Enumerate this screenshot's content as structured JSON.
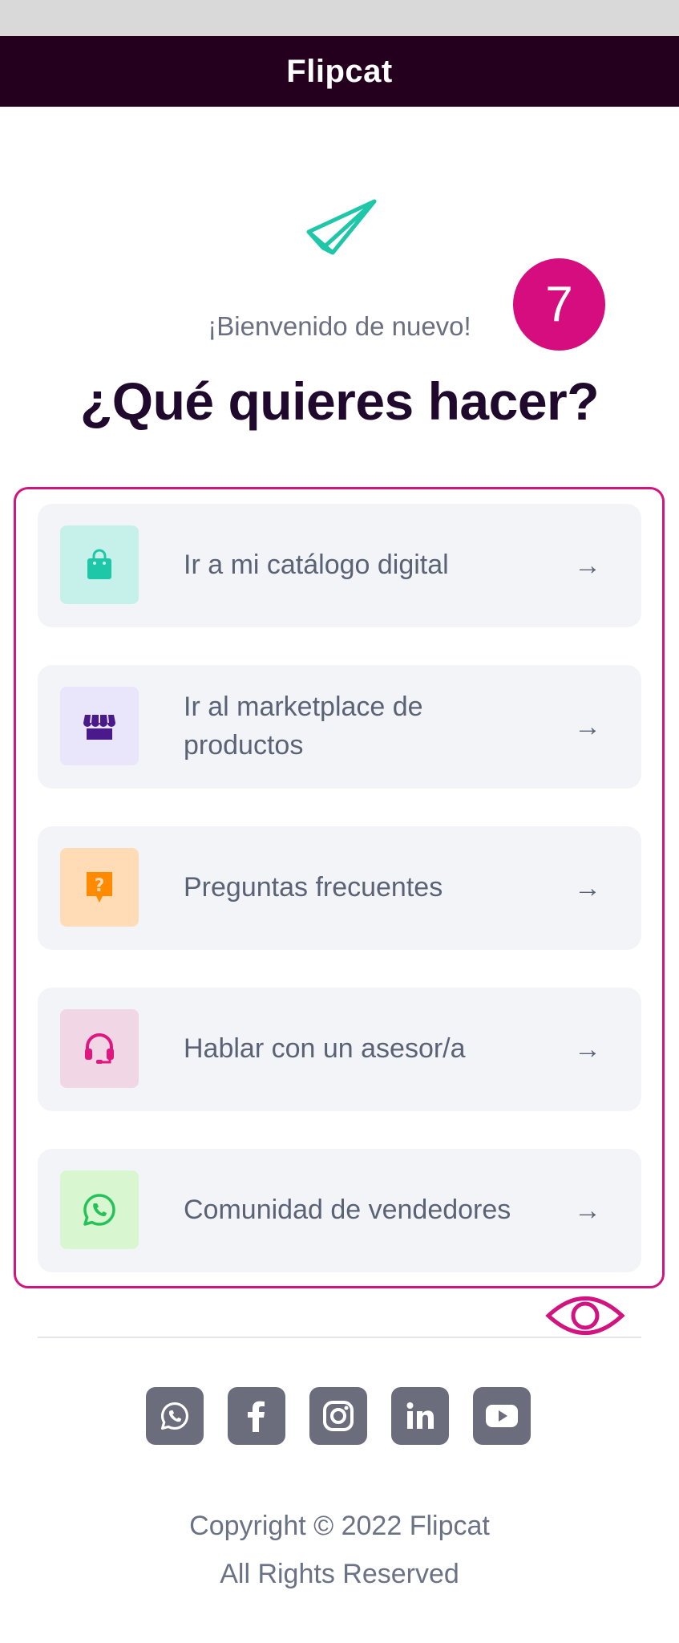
{
  "header": {
    "title": "Flipcat"
  },
  "logo": {
    "icon": "paper-plane-icon",
    "color": "#1ec7a8"
  },
  "welcome_text": "¡Bienvenido de nuevo!",
  "question": "¿Qué quieres hacer?",
  "step_badge": {
    "number": "7",
    "color": "#d60d7e"
  },
  "options": [
    {
      "label": "Ir a mi catálogo digital",
      "icon": "shopping-bag-icon",
      "icon_bg": "#c5f1ea",
      "icon_color": "#1ec7a8",
      "arrow": "→"
    },
    {
      "label": "Ir al marketplace de productos",
      "icon": "store-icon",
      "icon_bg": "#e9e5fb",
      "icon_color": "#4a1a8c",
      "arrow": "→"
    },
    {
      "label": "Preguntas frecuentes",
      "icon": "question-icon",
      "icon_bg": "#ffdcb5",
      "icon_color": "#ff8a00",
      "arrow": "→"
    },
    {
      "label": "Hablar con un asesor/a",
      "icon": "headset-icon",
      "icon_bg": "#f1d6e6",
      "icon_color": "#e0177f",
      "arrow": "→"
    },
    {
      "label": "Comunidad de vendedores",
      "icon": "whatsapp-icon",
      "icon_bg": "#d8f6cf",
      "icon_color": "#25c25a",
      "arrow": "→"
    }
  ],
  "social": [
    "whatsapp-icon",
    "facebook-icon",
    "instagram-icon",
    "linkedin-icon",
    "youtube-icon"
  ],
  "footer": {
    "copyright": "Copyright © 2022 Flipcat",
    "rights": "All Rights Reserved"
  }
}
